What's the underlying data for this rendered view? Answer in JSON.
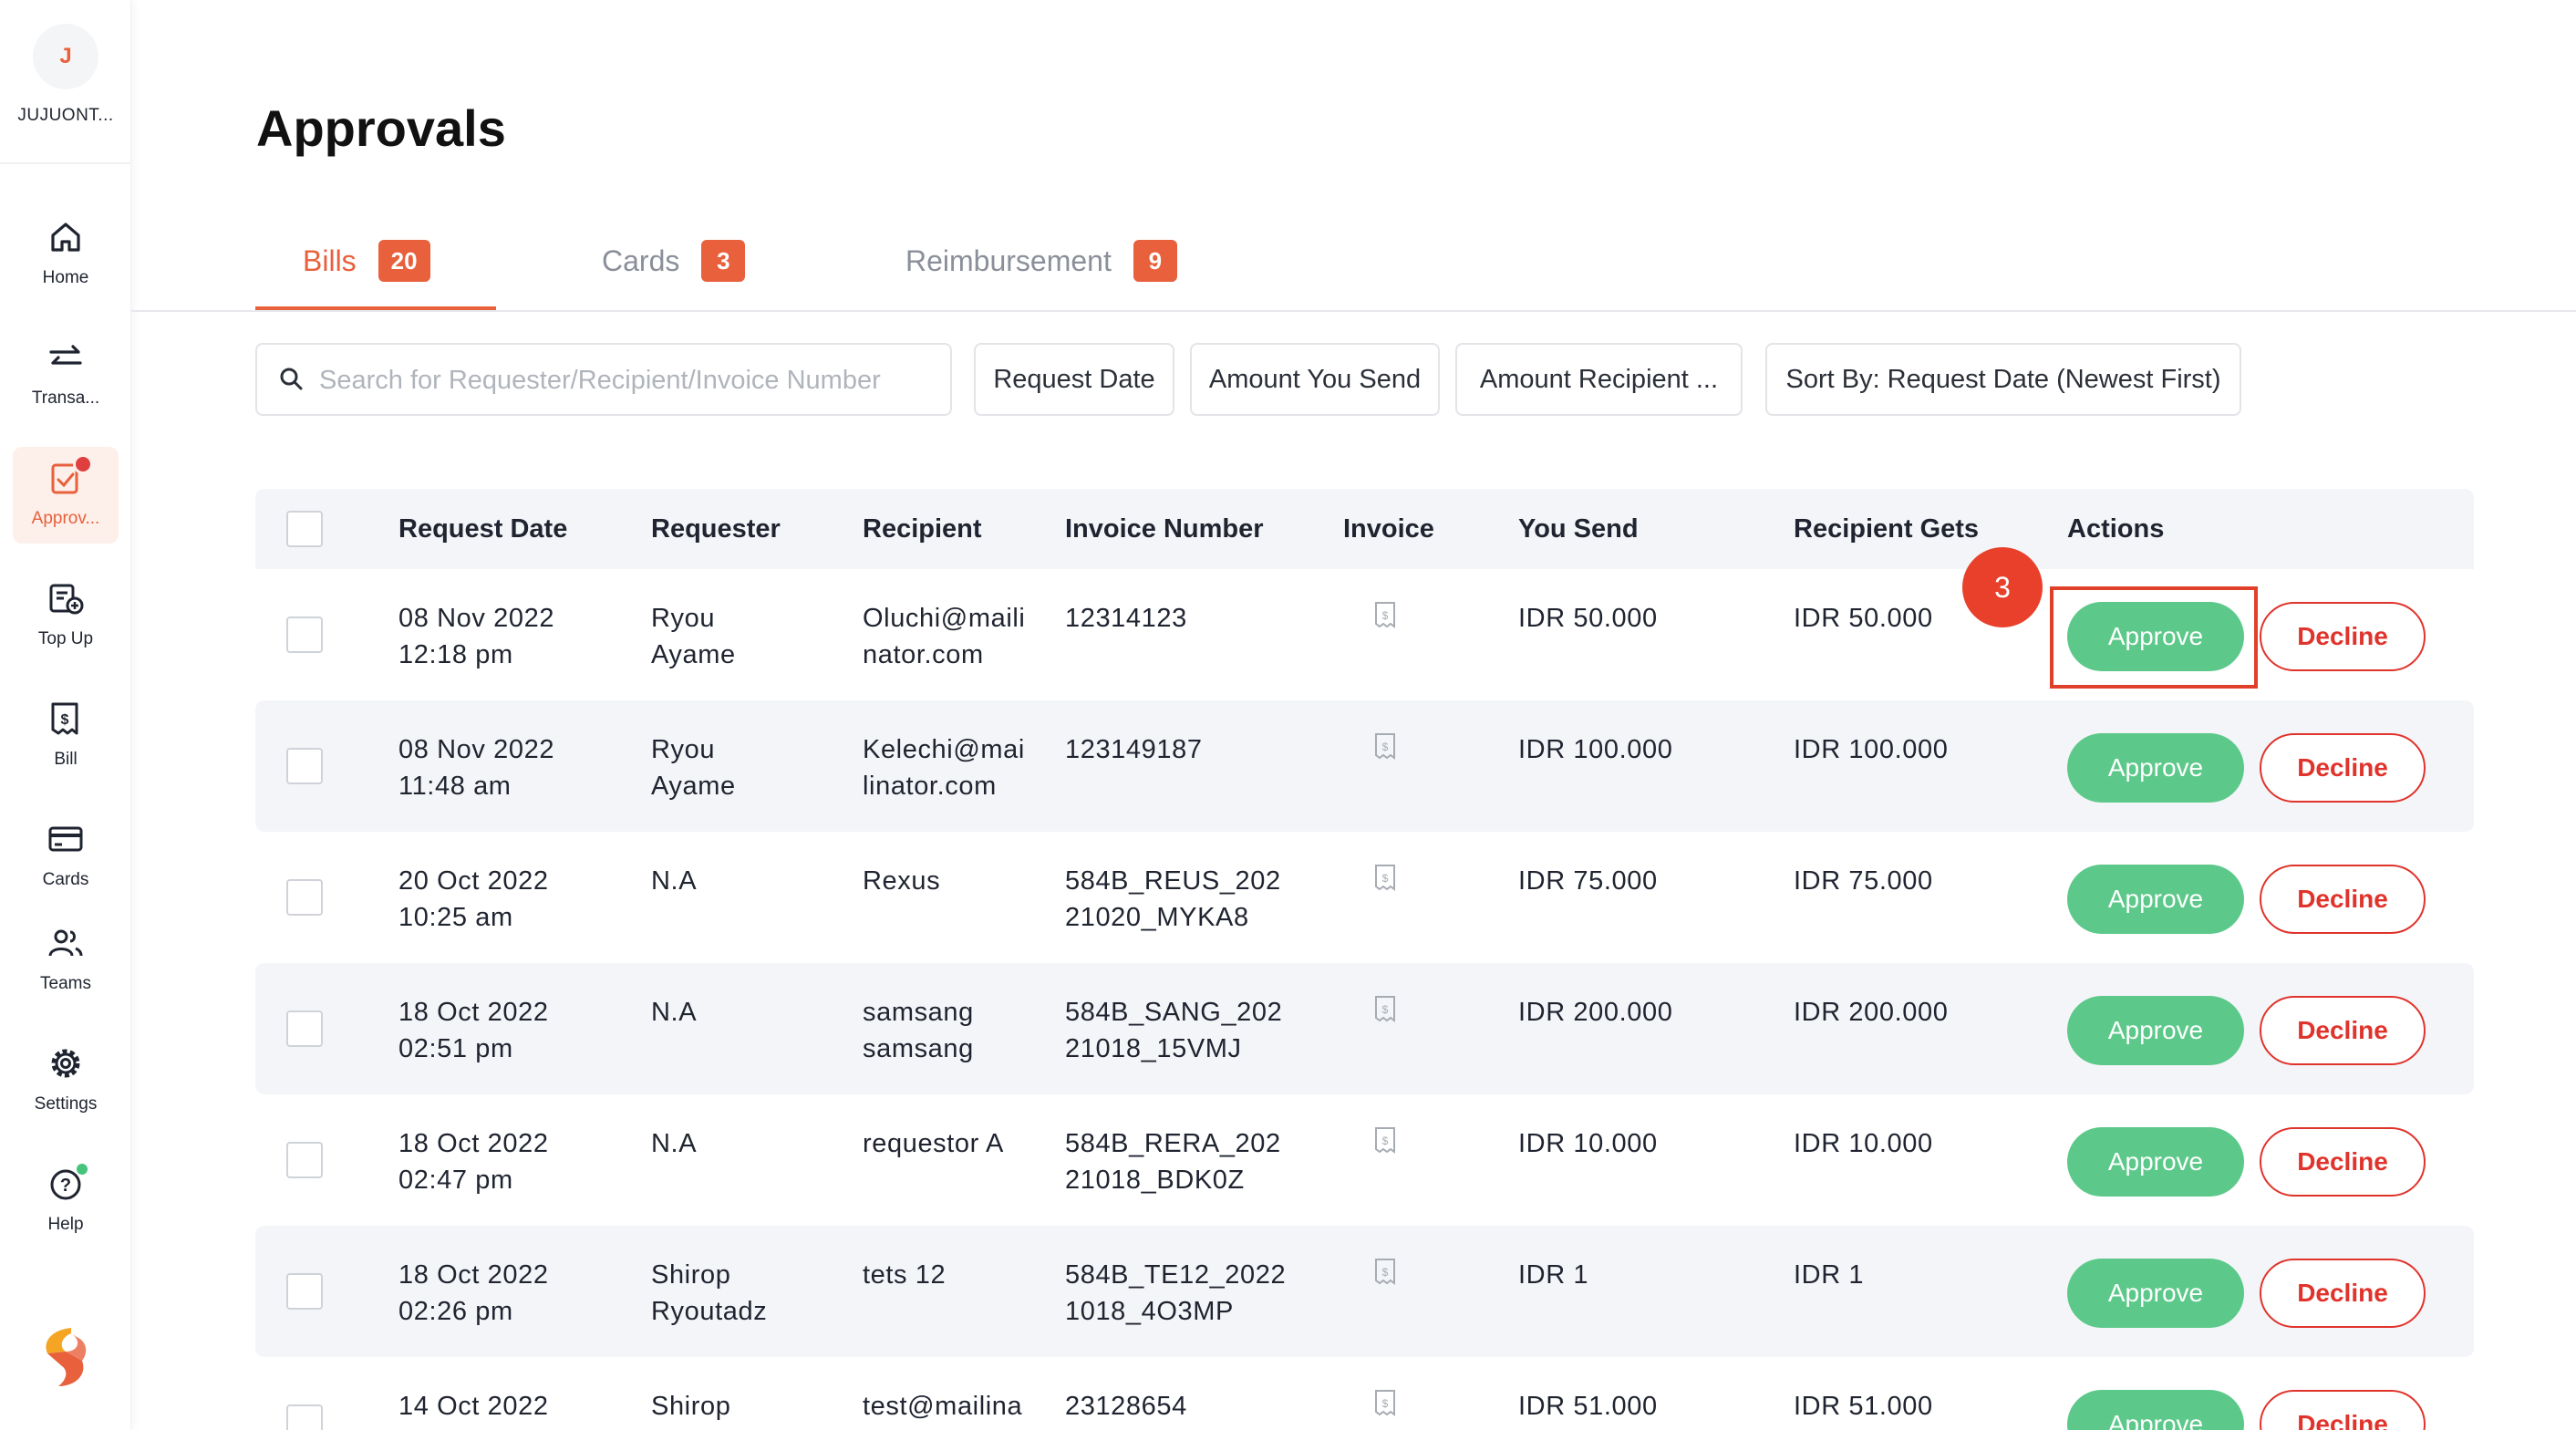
{
  "sidebar": {
    "user": {
      "initial": "J",
      "name": "JUJUONT..."
    },
    "items": [
      {
        "label": "Home",
        "icon": "home-icon"
      },
      {
        "label": "Transa...",
        "icon": "transfer-icon"
      },
      {
        "label": "Approv...",
        "icon": "approval-icon",
        "active": true
      },
      {
        "label": "Top Up",
        "icon": "top-up-icon"
      },
      {
        "label": "Bill",
        "icon": "bill-icon"
      },
      {
        "label": "Cards",
        "icon": "card-icon"
      },
      {
        "label": "Teams",
        "icon": "teams-icon"
      },
      {
        "label": "Settings",
        "icon": "gear-icon"
      },
      {
        "label": "Help",
        "icon": "help-icon"
      }
    ]
  },
  "page": {
    "title": "Approvals"
  },
  "tabs": [
    {
      "label": "Bills",
      "count": "20",
      "active": true
    },
    {
      "label": "Cards",
      "count": "3"
    },
    {
      "label": "Reimbursement",
      "count": "9"
    }
  ],
  "filters": {
    "search_placeholder": "Search for Requester/Recipient/Invoice Number",
    "request_date": "Request Date",
    "amount_send": "Amount You Send",
    "amount_recipient": "Amount Recipient ...",
    "sort": "Sort By: Request Date (Newest First)"
  },
  "table": {
    "headers": [
      "Request Date",
      "Requester",
      "Recipient",
      "Invoice Number",
      "Invoice",
      "You Send",
      "Recipient Gets",
      "Actions"
    ],
    "rows": [
      {
        "date": "08 Nov 2022",
        "time": "12:18 pm",
        "req1": "Ryou",
        "req2": "Ayame",
        "rec1": "Oluchi@maili",
        "rec2": "nator.com",
        "inv1": "12314123",
        "inv2": "",
        "send": "IDR 50.000",
        "gets": "IDR 50.000"
      },
      {
        "date": "08 Nov 2022",
        "time": "11:48 am",
        "req1": "Ryou",
        "req2": "Ayame",
        "rec1": "Kelechi@mai",
        "rec2": "linator.com",
        "inv1": "123149187",
        "inv2": "",
        "send": "IDR 100.000",
        "gets": "IDR 100.000"
      },
      {
        "date": "20 Oct 2022",
        "time": "10:25 am",
        "req1": "N.A",
        "req2": "",
        "rec1": "Rexus",
        "rec2": "",
        "inv1": "584B_REUS_202",
        "inv2": "21020_MYKA8",
        "send": "IDR 75.000",
        "gets": "IDR 75.000"
      },
      {
        "date": "18 Oct 2022",
        "time": "02:51 pm",
        "req1": "N.A",
        "req2": "",
        "rec1": "samsang",
        "rec2": "samsang",
        "inv1": "584B_SANG_202",
        "inv2": "21018_15VMJ",
        "send": "IDR 200.000",
        "gets": "IDR 200.000"
      },
      {
        "date": "18 Oct 2022",
        "time": "02:47 pm",
        "req1": "N.A",
        "req2": "",
        "rec1": "requestor A",
        "rec2": "",
        "inv1": "584B_RERA_202",
        "inv2": "21018_BDK0Z",
        "send": "IDR 10.000",
        "gets": "IDR 10.000"
      },
      {
        "date": "18 Oct 2022",
        "time": "02:26 pm",
        "req1": "Shirop",
        "req2": "Ryoutadz",
        "rec1": "tets 12",
        "rec2": "",
        "inv1": "584B_TE12_2022",
        "inv2": "1018_4O3MP",
        "send": "IDR 1",
        "gets": "IDR 1"
      },
      {
        "date": "14 Oct 2022",
        "time": "",
        "req1": "Shirop",
        "req2": "",
        "rec1": "test@mailina",
        "rec2": "",
        "inv1": "23128654",
        "inv2": "",
        "send": "IDR 51.000",
        "gets": "IDR 51.000"
      }
    ],
    "approve_label": "Approve",
    "decline_label": "Decline"
  },
  "annotation": {
    "step": "3"
  },
  "colors": {
    "accent": "#e8603c",
    "approve": "#5cc98a",
    "decline": "#e0332b"
  }
}
